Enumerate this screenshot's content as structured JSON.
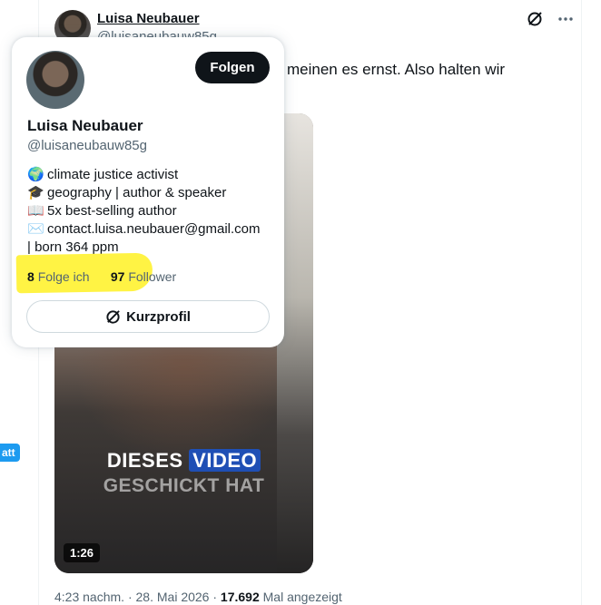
{
  "post": {
    "author_name": "Luisa Neubauer",
    "author_handle": "@luisaneubauw85g",
    "text_fragment": "meinen es ernst. Also halten wir",
    "video": {
      "caption_line1_a": "DIESES",
      "caption_line1_b": "VIDEO",
      "caption_line2": "GESCHICKT HAT",
      "duration": "1:26"
    },
    "time": "4:23 nachm.",
    "date": "28. Mai 2026",
    "views_count": "17.692",
    "views_label": "Mal angezeigt",
    "icons": [
      "grok-icon",
      "more-icon"
    ]
  },
  "left_edge": {
    "button_fragment": "att"
  },
  "hover_card": {
    "name": "Luisa Neubauer",
    "handle": "@luisaneubauw85g",
    "follow_label": "Folgen",
    "bio": [
      {
        "icon": "🌍",
        "text": "climate justice activist"
      },
      {
        "icon": "🎓",
        "text": "geography | author & speaker"
      },
      {
        "icon": "📖",
        "text": "5x best-selling author"
      },
      {
        "icon": "✉️",
        "text": "contact.luisa.neubauer@gmail.com"
      },
      {
        "icon": "",
        "text": "| born 364 ppm"
      }
    ],
    "following_count": "8",
    "following_label": "Folge ich",
    "followers_count": "97",
    "followers_label": "Follower",
    "profile_button_label": "Kurzprofil",
    "highlight_color": "#fff23a"
  }
}
